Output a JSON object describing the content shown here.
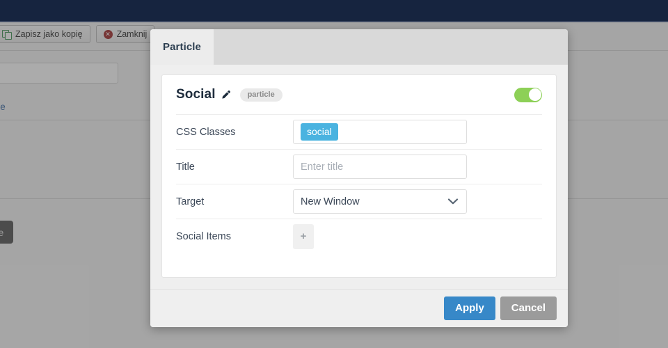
{
  "background": {
    "toolbar_buttons": [
      {
        "label": "Zapisz jako kopię",
        "icon": "copy-icon"
      },
      {
        "label": "Zamknij",
        "icon": "close-circle-icon"
      }
    ],
    "link_text": "ogacone",
    "tooltip_text": "article",
    "navbar_color": "#16243f"
  },
  "modal": {
    "tabs": [
      {
        "label": "Particle",
        "active": true
      }
    ],
    "panel": {
      "title": "Social",
      "edit_icon": "pencil-icon",
      "badge": "particle",
      "enabled_toggle": {
        "name": "enable-particle-toggle",
        "state": "on",
        "color": "#8dd057"
      },
      "fields": [
        {
          "label": "CSS Classes",
          "type": "tags",
          "tags": [
            "social"
          ],
          "tag_color": "#4ab3e0"
        },
        {
          "label": "Title",
          "type": "text",
          "value": "",
          "placeholder": "Enter title"
        },
        {
          "label": "Target",
          "type": "select",
          "value": "New Window"
        },
        {
          "label": "Social Items",
          "type": "collection",
          "add_label": "+"
        }
      ]
    },
    "footer": {
      "apply_label": "Apply",
      "cancel_label": "Cancel",
      "apply_color": "#3788c8",
      "cancel_color": "#9b9b9b"
    }
  }
}
